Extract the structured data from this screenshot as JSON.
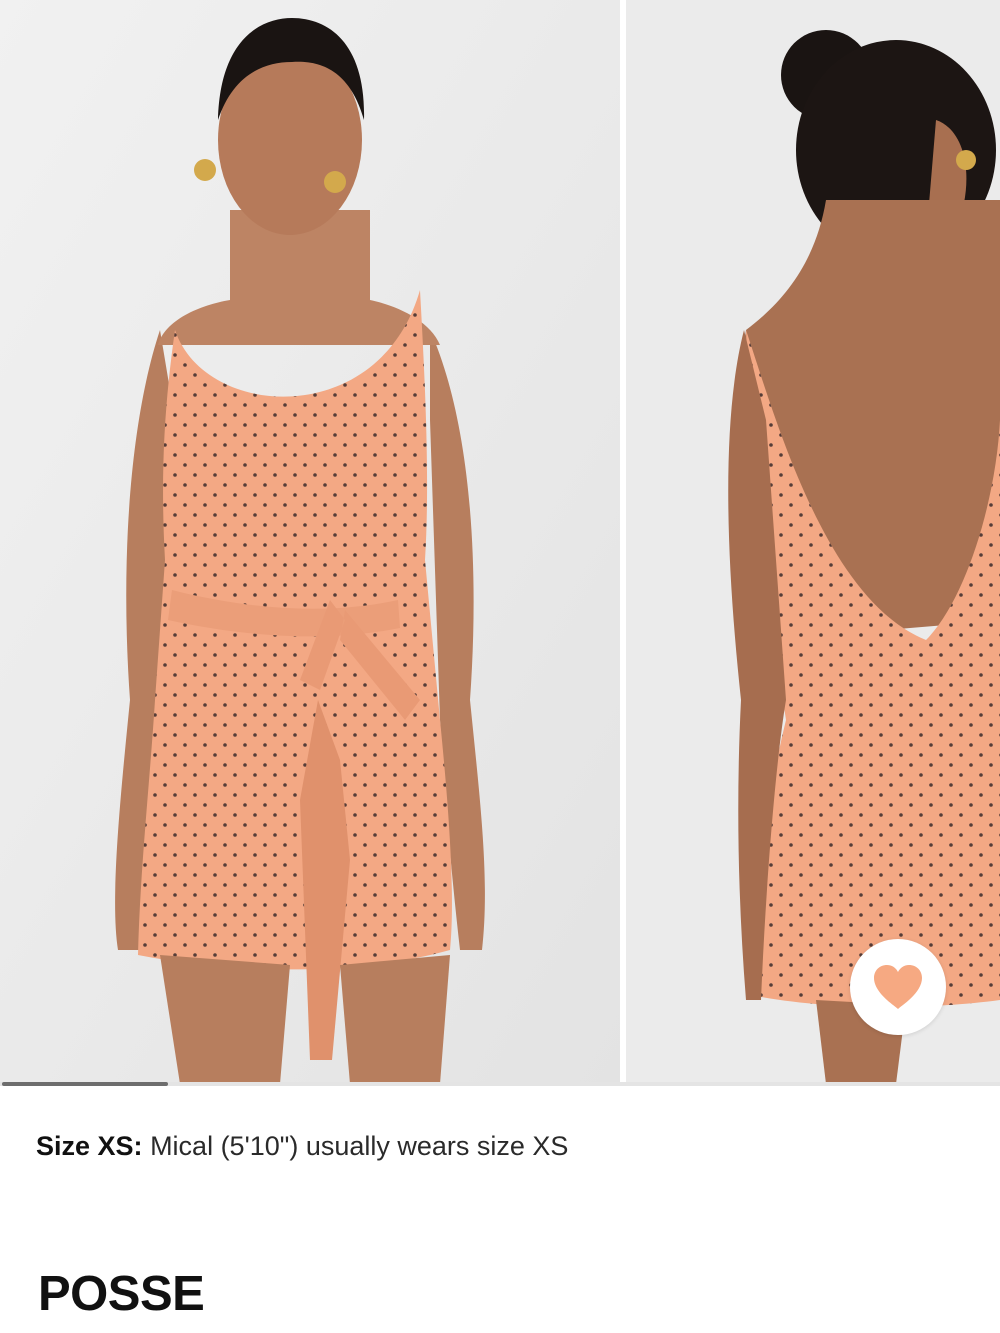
{
  "gallery": {
    "images": [
      {
        "name": "front-view",
        "description_icon": "model-front-photo"
      },
      {
        "name": "back-view",
        "description_icon": "model-back-photo"
      }
    ],
    "active_index": 0,
    "total_images": 2,
    "favorite_icon": "heart-icon",
    "accent_color": "#f6a982",
    "dress_color": "#f3a884",
    "dot_color": "#3a2a2a"
  },
  "sizing": {
    "label": "Size XS:",
    "text": "Mical (5'10\") usually wears size XS"
  },
  "brand": {
    "name": "POSSE"
  }
}
